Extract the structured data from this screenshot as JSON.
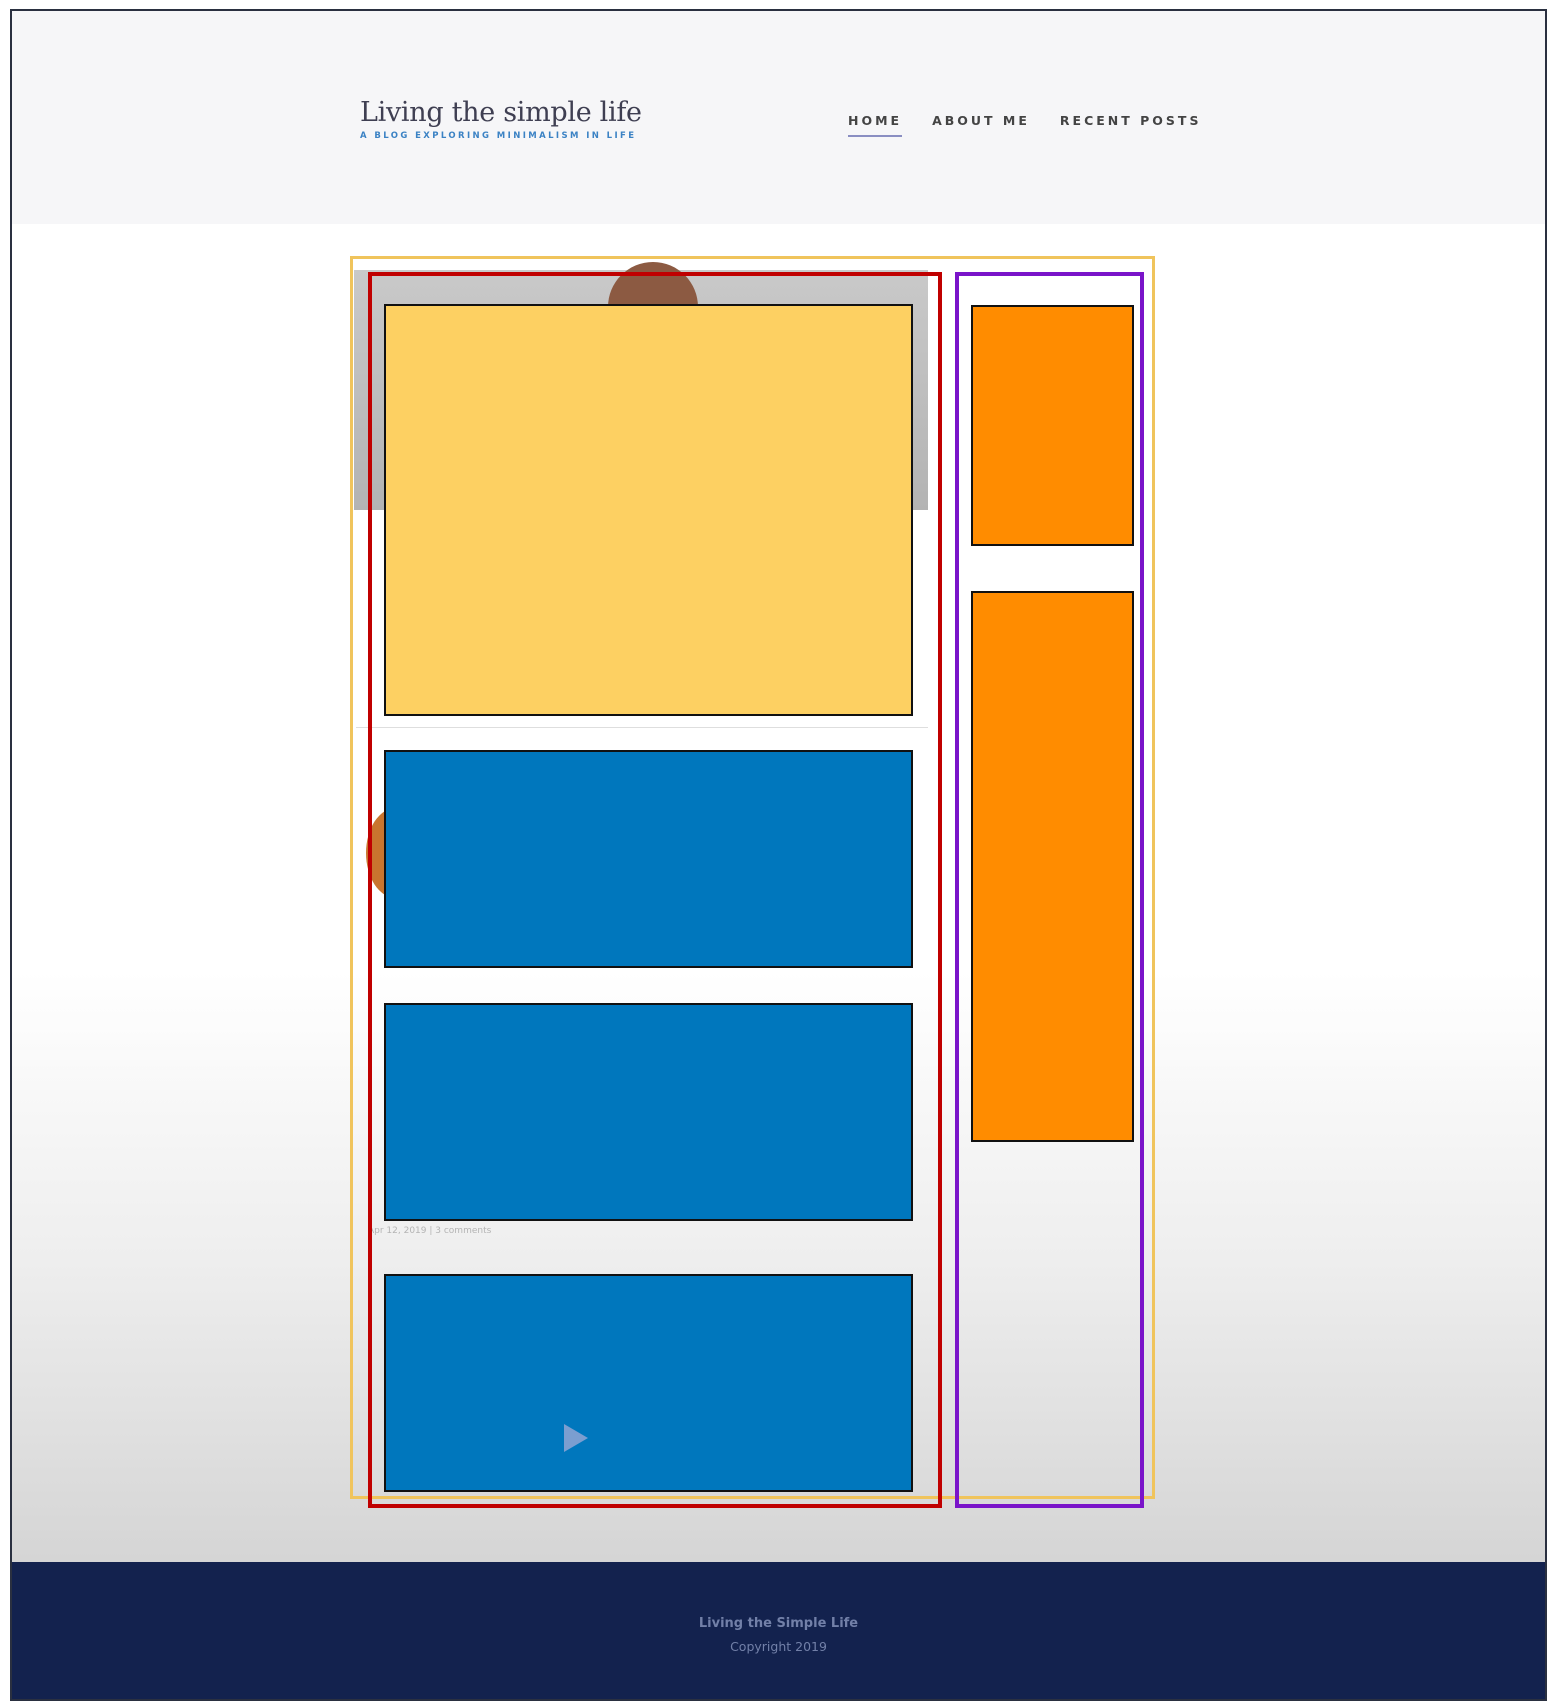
{
  "header": {
    "site_title": "Living the simple life",
    "tagline": "A BLOG EXPLORING MINIMALISM IN LIFE",
    "nav": [
      {
        "label": "HOME",
        "active": true
      },
      {
        "label": "ABOUT ME",
        "active": false
      },
      {
        "label": "RECENT POSTS",
        "active": false
      }
    ]
  },
  "layout_overlay": {
    "colors": {
      "container_outline": "#f0c45c",
      "main_column_outline": "#c00000",
      "sidebar_outline": "#7a14c9",
      "featured_block": "#fdd062",
      "post_block": "#0077bd",
      "widget_block": "#ff8c00"
    }
  },
  "posts_meta": {
    "post_3": "Apr 12, 2019  |  3 comments"
  },
  "footer": {
    "title": "Living the Simple Life",
    "copyright": "Copyright 2019"
  }
}
